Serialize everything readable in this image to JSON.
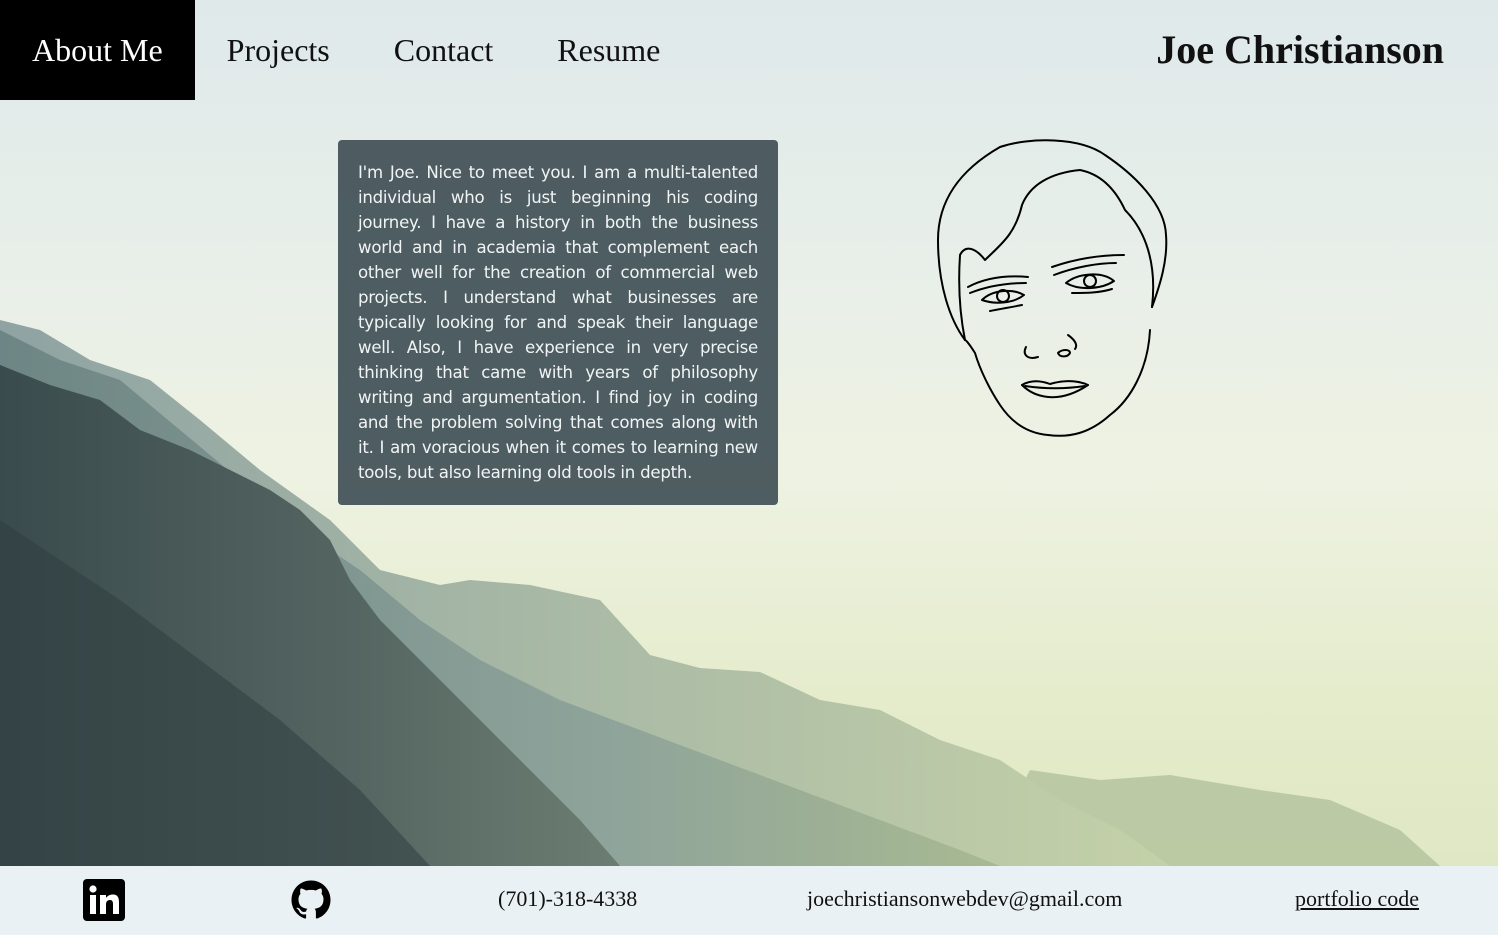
{
  "nav": {
    "items": [
      {
        "label": "About Me",
        "active": true
      },
      {
        "label": "Projects",
        "active": false
      },
      {
        "label": "Contact",
        "active": false
      },
      {
        "label": "Resume",
        "active": false
      }
    ]
  },
  "header": {
    "title": "Joe Christianson"
  },
  "about": {
    "text": "I'm Joe. Nice to meet you. I am a multi-talented individual who is just beginning his coding journey. I have a history in both the business world and in academia that complement each other well for the creation of commercial web projects. I understand what businesses are typically looking for and speak their language well. Also, I have experience in very precise thinking that came with years of philosophy writing and argumentation. I find joy in coding and the problem solving that comes along with it. I am voracious when it comes to learning new tools, but also learning old tools in depth."
  },
  "footer": {
    "linkedin_icon": "linkedin-icon",
    "github_icon": "github-icon",
    "phone": "(701)-318-4338",
    "email": "joechristiansonwebdev@gmail.com",
    "portfolio_link": "portfolio code"
  },
  "colors": {
    "nav_active_bg": "#000000",
    "card_bg": "#46545a",
    "footer_bg": "#eaf1f4"
  }
}
